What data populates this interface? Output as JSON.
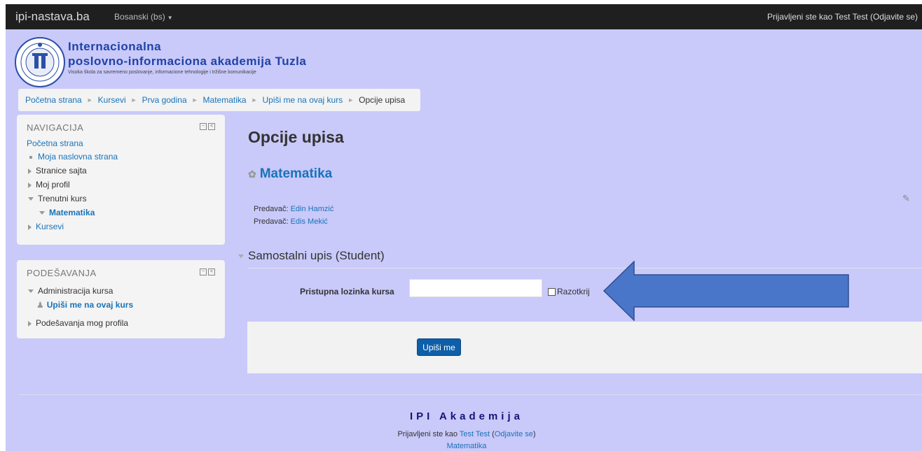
{
  "navbar": {
    "brand": "ipi-nastava.ba",
    "language": "Bosanski (bs)",
    "login_prefix": "Prijavljeni ste kao ",
    "login_user": "Test Test",
    "logout_full": "(Odjavite se)"
  },
  "header": {
    "line1": "Internacionalna",
    "line2": "poslovno-informaciona akademija Tuzla",
    "line3": "Visoka škola za savremeno poslovanje, informacione tehnologije i tržišne komunikacije"
  },
  "breadcrumb": {
    "items": [
      "Početna strana",
      "Kursevi",
      "Prva godina",
      "Matematika",
      "Upiši me na ovaj kurs"
    ],
    "current": "Opcije upisa"
  },
  "navigation": {
    "title": "NAVIGACIJA",
    "home": "Početna strana",
    "items": [
      {
        "label": "Moja naslovna strana"
      },
      {
        "label": "Stranice sajta"
      },
      {
        "label": "Moj profil"
      },
      {
        "label": "Trenutni kurs"
      },
      {
        "label": "Matematika"
      },
      {
        "label": "Kursevi"
      }
    ]
  },
  "settings": {
    "title": "PODEŠAVANJA",
    "items": [
      {
        "label": "Administracija kursa"
      },
      {
        "label": "Upiši me na ovaj kurs"
      },
      {
        "label": "Podešavanja mog profila"
      }
    ]
  },
  "main": {
    "title": "Opcije upisa",
    "course": "Matematika",
    "teacher_label": "Predavač:",
    "teachers": [
      "Edin Hamzić",
      "Edis Mekić"
    ],
    "section": "Samostalni upis (Student)",
    "password_label": "Pristupna lozinka kursa",
    "password_value": "",
    "reveal_label": "Razotkrij",
    "reveal_checked": false,
    "submit_label": "Upiši me"
  },
  "footer": {
    "title": "IPI Akademija",
    "login_prefix": "Prijavljeni ste kao ",
    "user": "Test Test",
    "logout": "Odjavite se",
    "course_link": "Matematika"
  },
  "colors": {
    "page_bg": "#c9c9fa",
    "navbar": "#1f1f1f",
    "link": "#1a73b8",
    "button": "#0e5ea8",
    "arrow": "#4a76c9"
  },
  "icons": [
    "logo-seal",
    "course-icon",
    "edit-icon",
    "user-icon",
    "block-collapse-icon",
    "block-dock-icon"
  ]
}
